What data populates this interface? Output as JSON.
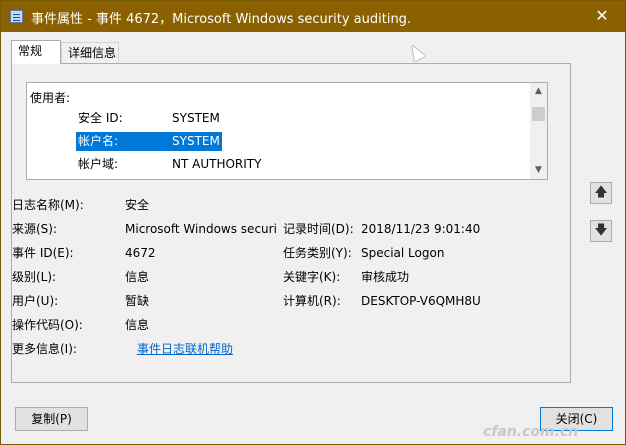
{
  "window": {
    "title": "事件属性 - 事件 4672，Microsoft Windows security auditing.",
    "close_glyph": "✕"
  },
  "tabs": [
    {
      "label": "常规",
      "active": true
    },
    {
      "label": "详细信息",
      "active": false
    }
  ],
  "message": {
    "label": "使用者:",
    "rows": [
      {
        "key": "安全 ID:",
        "value": "SYSTEM",
        "selected": false
      },
      {
        "key": "帐户名:",
        "value": "SYSTEM",
        "selected": true
      },
      {
        "key": "帐户域:",
        "value": "NT AUTHORITY",
        "selected": false
      }
    ]
  },
  "fields": {
    "log_name": {
      "label": "日志名称(M):",
      "value": "安全"
    },
    "source": {
      "label": "来源(S):",
      "value": "Microsoft Windows securi"
    },
    "logged": {
      "label": "记录时间(D):",
      "value": "2018/11/23 9:01:40"
    },
    "event_id": {
      "label": "事件 ID(E):",
      "value": "4672"
    },
    "task_category": {
      "label": "任务类别(Y):",
      "value": "Special Logon"
    },
    "level": {
      "label": "级别(L):",
      "value": "信息"
    },
    "keywords": {
      "label": "关键字(K):",
      "value": "审核成功"
    },
    "user": {
      "label": "用户(U):",
      "value": "暂缺"
    },
    "computer": {
      "label": "计算机(R):",
      "value": "DESKTOP-V6QMH8U"
    },
    "opcode": {
      "label": "操作代码(O):",
      "value": "信息"
    },
    "more_info": {
      "label": "更多信息(I):",
      "link": "事件日志联机帮助"
    }
  },
  "buttons": {
    "copy": "复制(P)",
    "close": "关闭(C)"
  },
  "watermark": "cfan.com.cn"
}
